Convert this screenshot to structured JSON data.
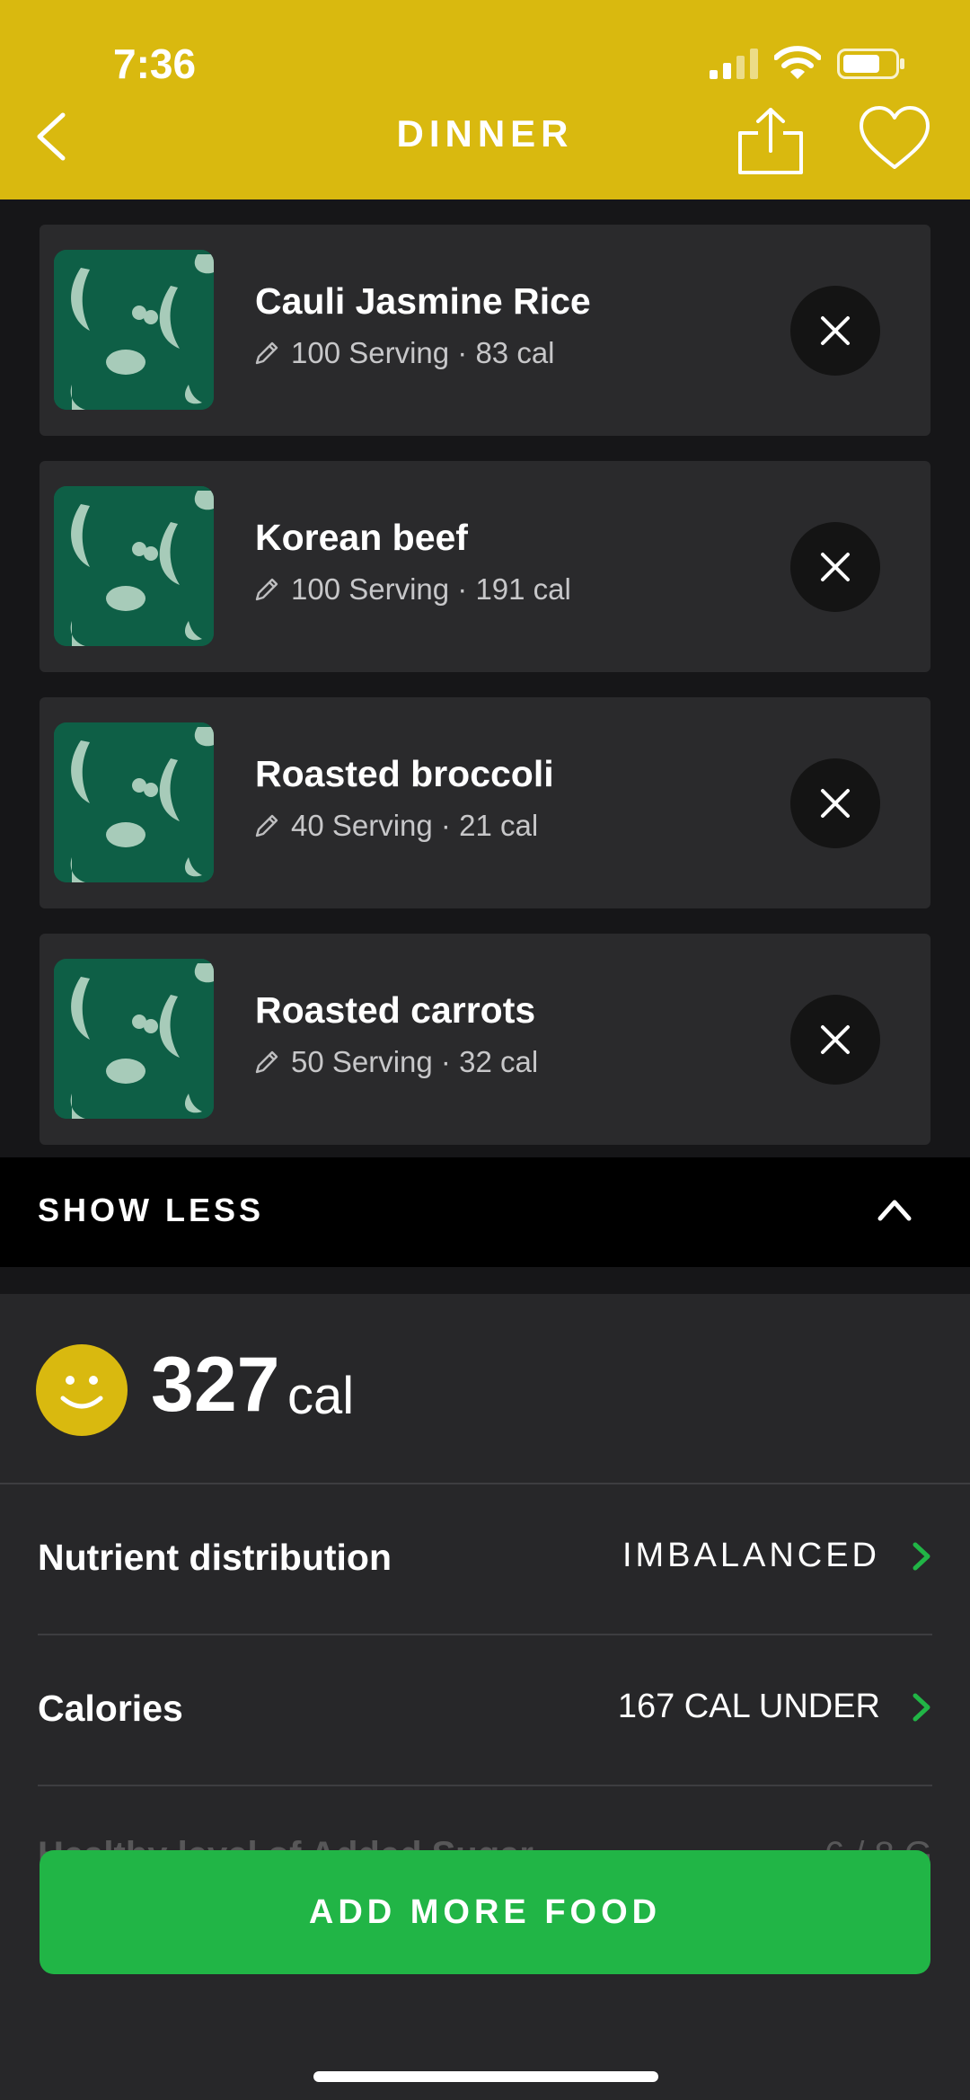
{
  "status_bar": {
    "time": "7:36"
  },
  "header": {
    "title": "DINNER"
  },
  "foods": [
    {
      "name": "Cauli Jasmine Rice",
      "serving": "100 Serving · 83 cal"
    },
    {
      "name": "Korean beef",
      "serving": "100 Serving · 191 cal"
    },
    {
      "name": "Roasted broccoli",
      "serving": "40 Serving · 21 cal"
    },
    {
      "name": "Roasted carrots",
      "serving": "50 Serving · 32 cal"
    }
  ],
  "toggle": {
    "label": "SHOW LESS"
  },
  "summary": {
    "calories": "327",
    "unit": "cal",
    "metrics": [
      {
        "label": "Nutrient distribution",
        "value": "IMBALANCED"
      },
      {
        "label": "Calories",
        "value": "167 CAL UNDER"
      }
    ],
    "partial_row": {
      "label": "Healthy level of Added Sugar",
      "value": "6 / 8 G"
    }
  },
  "add_button": {
    "label": "ADD MORE FOOD"
  },
  "colors": {
    "header": "#d9b90f",
    "accent_green": "#21b546",
    "thumb": "#0e5f46"
  }
}
